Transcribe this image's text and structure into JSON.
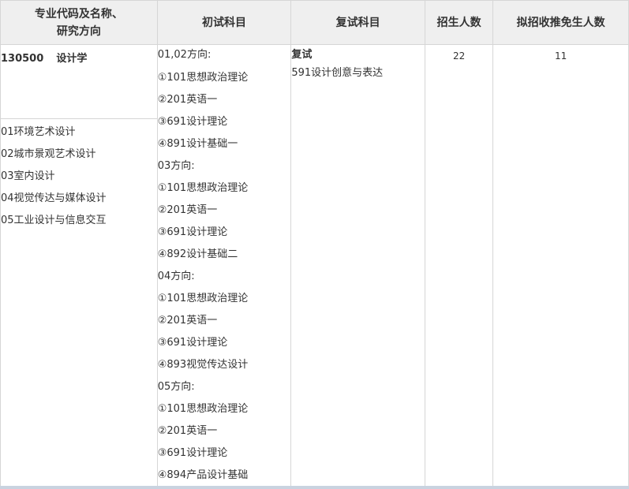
{
  "headers": {
    "major_line1": "专业代码及名称、",
    "major_line2": "研究方向",
    "initial_exam": "初试科目",
    "retest": "复试科目",
    "enrollment": "招生人数",
    "exempt": "拟招收推免生人数"
  },
  "major": {
    "code": "130500",
    "name": "设计学",
    "directions": [
      "01环境艺术设计",
      "02城市景观艺术设计",
      "03室内设计",
      "04视觉传达与媒体设计",
      "05工业设计与信息交互"
    ]
  },
  "initial_exam_lines": [
    "01,02方向:",
    "①101思想政治理论",
    "②201英语一",
    "③691设计理论",
    "④891设计基础一",
    "03方向:",
    "①101思想政治理论",
    "②201英语一",
    "③691设计理论",
    "④892设计基础二",
    "04方向:",
    "①101思想政治理论",
    "②201英语一",
    "③691设计理论",
    "④893视觉传达设计",
    "05方向:",
    "①101思想政治理论",
    "②201英语一",
    "③691设计理论",
    "④894产品设计基础"
  ],
  "retest": {
    "title": "复试",
    "subject": "591设计创意与表达"
  },
  "enrollment_count": "22",
  "exempt_count": "11"
}
